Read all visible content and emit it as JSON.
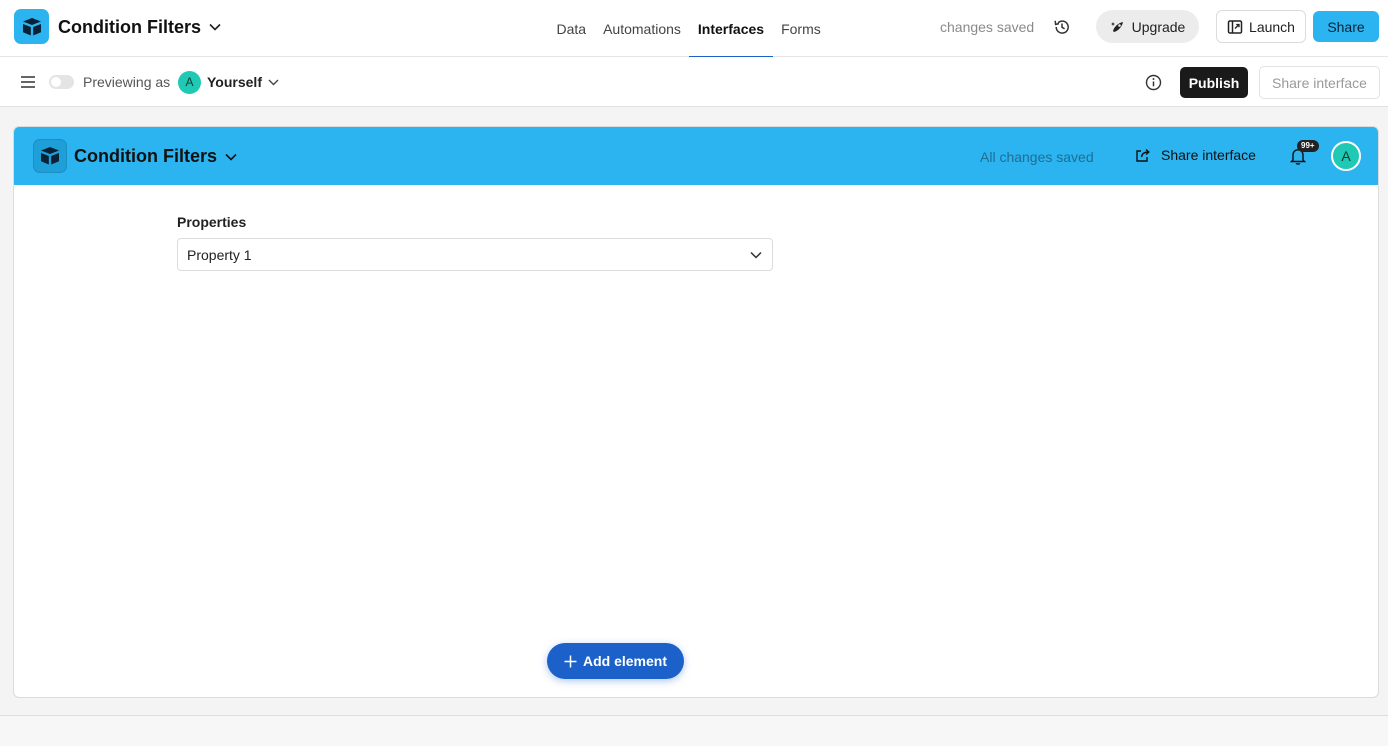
{
  "app": {
    "base_title": "Condition Filters",
    "logo_icon": "airtable-logo-icon"
  },
  "nav": {
    "tabs": [
      {
        "label": "Data",
        "active": false
      },
      {
        "label": "Automations",
        "active": false
      },
      {
        "label": "Interfaces",
        "active": true
      },
      {
        "label": "Forms",
        "active": false
      }
    ]
  },
  "topbar": {
    "saved_status": "changes saved",
    "upgrade_label": "Upgrade",
    "launch_label": "Launch",
    "share_label": "Share"
  },
  "toolbar": {
    "previewing_label": "Previewing as",
    "user_initial": "A",
    "user_name": "Yourself",
    "publish_label": "Publish",
    "share_interface_label": "Share interface"
  },
  "interface": {
    "title": "Condition Filters",
    "saved_status": "All changes saved",
    "share_label": "Share interface",
    "notification_badge": "99+",
    "avatar_initial": "A",
    "field": {
      "label": "Properties",
      "value": "Property 1"
    },
    "add_element_label": "Add element"
  },
  "colors": {
    "brand_blue": "#2bb4f0",
    "primary_blue": "#1b61c9",
    "avatar_teal": "#20c9b3",
    "publish_black": "#1a1a1a"
  }
}
